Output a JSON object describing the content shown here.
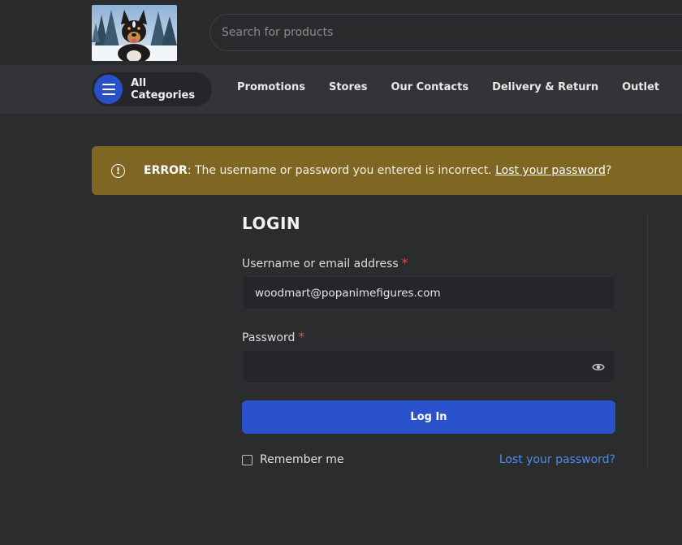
{
  "header": {
    "search_placeholder": "Search for products"
  },
  "categories": {
    "label": "All Categories"
  },
  "nav": {
    "items": [
      "Promotions",
      "Stores",
      "Our Contacts",
      "Delivery & Return",
      "Outlet"
    ]
  },
  "notice": {
    "icon": "exclamation-circle-icon",
    "strong": "ERROR",
    "message": ": The username or password you entered is incorrect. ",
    "link": "Lost your password",
    "suffix": "?"
  },
  "login": {
    "title": "LOGIN",
    "username_label": "Username or email address",
    "username_value": "woodmart@popanimefigures.com",
    "password_label": "Password",
    "password_value": "",
    "required_mark": "*",
    "submit_label": "Log In",
    "remember_label": "Remember me",
    "lost_password_link": "Lost your password?"
  },
  "colors": {
    "primary": "#2a52cc",
    "notice_bg": "#7f6622",
    "link": "#4d8fe8",
    "required": "#e04b4b"
  }
}
